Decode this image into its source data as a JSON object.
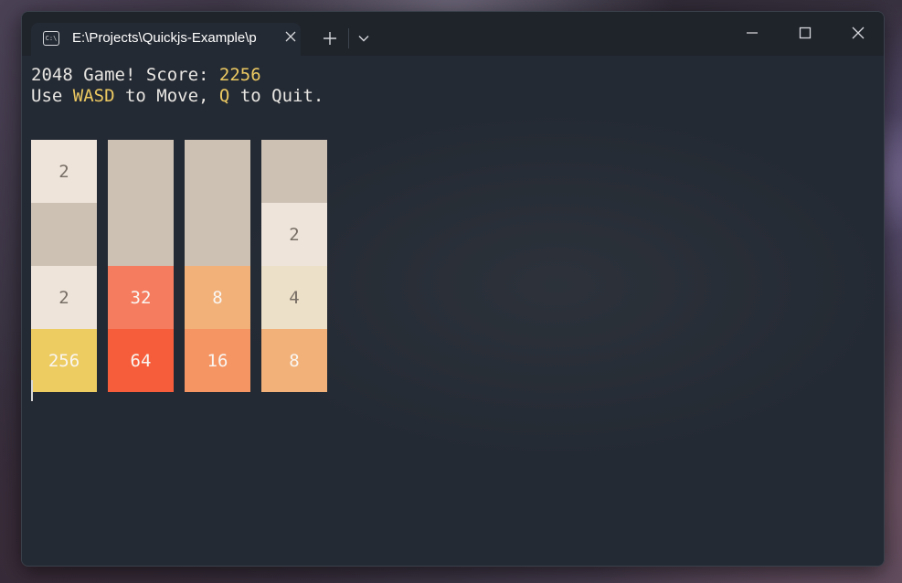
{
  "window": {
    "tab_title": "E:\\Projects\\Quickjs-Example\\p",
    "tab_icon": "terminal-icon",
    "buttons": {
      "new_tab": "plus-icon",
      "dropdown": "chevron-down-icon",
      "minimize": "minimize-icon",
      "maximize": "maximize-icon",
      "close": "close-icon"
    }
  },
  "terminal": {
    "line1_prefix": "2048 Game! Score: ",
    "score": "2256",
    "line2_use": "Use ",
    "line2_keys": "WASD",
    "line2_mid": " to Move, ",
    "line2_quit_key": "Q",
    "line2_end": " to Quit."
  },
  "board": {
    "columns": [
      [
        "2",
        "",
        "2",
        "256"
      ],
      [
        "",
        "",
        "32",
        "64"
      ],
      [
        "",
        "",
        "8",
        "16"
      ],
      [
        "",
        "2",
        "4",
        "8"
      ]
    ],
    "tile_colors": {
      "empty": "#cdc1b4",
      "2": "#eee4da",
      "4": "#ede0c8",
      "8": "#f2b179",
      "16": "#f59563",
      "32": "#f67c5f",
      "64": "#f65e3b",
      "256": "#edcc61"
    },
    "text_colors": {
      "dark": "#776e65",
      "light": "#f9f6f2"
    }
  }
}
